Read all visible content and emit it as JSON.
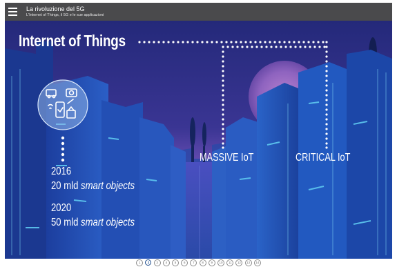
{
  "header": {
    "title": "La rivoluzione del 5G",
    "subtitle": "L'Internet of Things, il 5G e le sue applicazioni"
  },
  "slide": {
    "title": "Internet of Things",
    "massive_label": "MASSIVE IoT",
    "critical_label": "CRITICAL IoT",
    "stats": [
      {
        "year": "2016",
        "amount": "20 mld",
        "term": "smart objects"
      },
      {
        "year": "2020",
        "amount": "50 mld",
        "term": "smart objects"
      }
    ]
  },
  "pager": {
    "pages": [
      "1",
      "2",
      "3",
      "4",
      "5",
      "6",
      "7",
      "8",
      "9",
      "10",
      "11",
      "12",
      "13",
      "14"
    ],
    "current": "2"
  },
  "colors": {
    "header_bg": "#4a4a4c",
    "sky_top": "#2a2f86",
    "sky_glow": "#8b5bc4",
    "building_blue": "#1f4fb0",
    "light_cyan": "#58c8ef",
    "pager_active": "#1f4f8f"
  },
  "icons": [
    "menu-icon",
    "iot-devices-icon"
  ]
}
